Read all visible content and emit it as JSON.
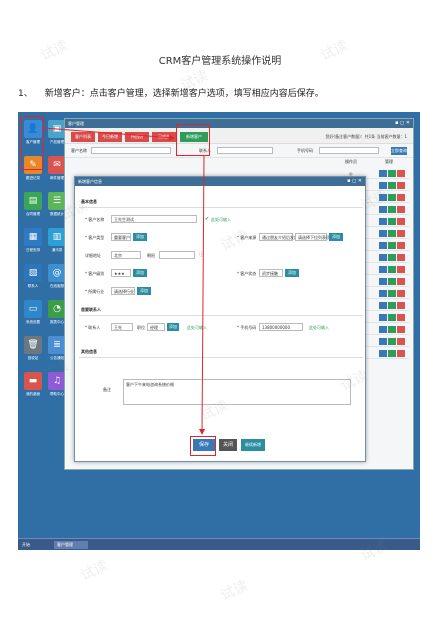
{
  "document": {
    "title": "CRM客户管理系统操作说明",
    "step_number": "1、",
    "step_text": "新增客户：点击客户管理，选择新增客户选项，填写相应内容后保存。"
  },
  "screenshot": {
    "desktop_icons": [
      {
        "label": "客户管理",
        "icon": "user-icon",
        "color": "#3a8bd6"
      },
      {
        "label": "产品管理",
        "icon": "box-icon",
        "color": "#4aa3c9"
      },
      {
        "label": "跟进记录",
        "icon": "edit-icon",
        "color": "#e8862a"
      },
      {
        "label": "邮件管理",
        "icon": "mail-icon",
        "color": "#d9534f"
      },
      {
        "label": "合同管理",
        "icon": "doc-icon",
        "color": "#3aa655"
      },
      {
        "label": "数据统计",
        "icon": "list-icon",
        "color": "#5bb55b"
      },
      {
        "label": "日程安排",
        "icon": "book-icon",
        "color": "#2e7bc4"
      },
      {
        "label": "通讯录",
        "icon": "grid-icon",
        "color": "#2c9fd6"
      },
      {
        "label": "联系人",
        "icon": "contact-icon",
        "color": "#2a76b8"
      },
      {
        "label": "在线客服",
        "icon": "at-icon",
        "color": "#3d8fd0"
      },
      {
        "label": "系统设置",
        "icon": "save-icon",
        "color": "#2f86c8"
      },
      {
        "label": "报表中心",
        "icon": "pie-icon",
        "color": "#3b9d48"
      },
      {
        "label": "回收站",
        "icon": "trash-icon",
        "color": "#6c7780"
      },
      {
        "label": "公告通知",
        "icon": "notes-icon",
        "color": "#4a8fd6"
      },
      {
        "label": "我的桌面",
        "icon": "card-icon",
        "color": "#d9534f"
      },
      {
        "label": "帮助中心",
        "icon": "bell-icon",
        "color": "#8e5ad6"
      }
    ],
    "taskbar": {
      "start": "开始",
      "app": "客户管理"
    },
    "window": {
      "title": "客户管理",
      "controls": "▪ ◻ ✕",
      "tabs": [
        "客户列表",
        "今日新增",
        "待回访",
        "已成交",
        "新增客户"
      ],
      "active_tab": "新增客户",
      "top_right": "您好(备注客户数量)：共1条  当前客户数量：1",
      "filter": {
        "name_label": "客户名称",
        "contact_label": "联系人",
        "phone_label": "手机号码",
        "search_button": "立即查询"
      },
      "grid_headers": [
        "操作员",
        "管理"
      ],
      "grid_rows": 16
    },
    "dialog": {
      "title": "新增客户信息",
      "section_basic": "基本信息",
      "section_contact": "首要联系人",
      "section_other": "其他信息",
      "fields": {
        "customer_name_label": "* 客户名称",
        "customer_name_value": "王先生测试",
        "customer_name_hint": "此处可输入",
        "customer_type_label": "* 客户类型",
        "customer_type_value": "重要客户",
        "customer_type_btn": "添加",
        "source_label": "* 客户来源",
        "source_value": "通过朋友介绍后发展",
        "source_value2": "请选择下拉列表项",
        "source_btn": "添加",
        "address_label": "详细地址",
        "address_value": "北京",
        "address_tail": "朝阳",
        "level_label": "* 客户级别",
        "level_value": "★★★",
        "level_btn": "添加",
        "status_label": "* 客户状态",
        "status_value": "初步接触",
        "status_btn": "添加",
        "industry_label": "* 所属行业",
        "industry_value": "请选择行业",
        "industry_btn": "添加",
        "contact_label": "* 联系人",
        "contact_value": "王先",
        "title_label": "职位",
        "title_value": "经理",
        "title_btn": "添加",
        "contact_hint": "此处可输入",
        "mobile_label": "* 手机号码",
        "mobile_value": "13800000000",
        "mobile_hint": "此处可输入",
        "note_label": "备注",
        "note_value": "客户下午来电咨询系统价格"
      },
      "buttons": {
        "save": "保存",
        "close": "关闭",
        "extra": "继续新增"
      }
    }
  }
}
